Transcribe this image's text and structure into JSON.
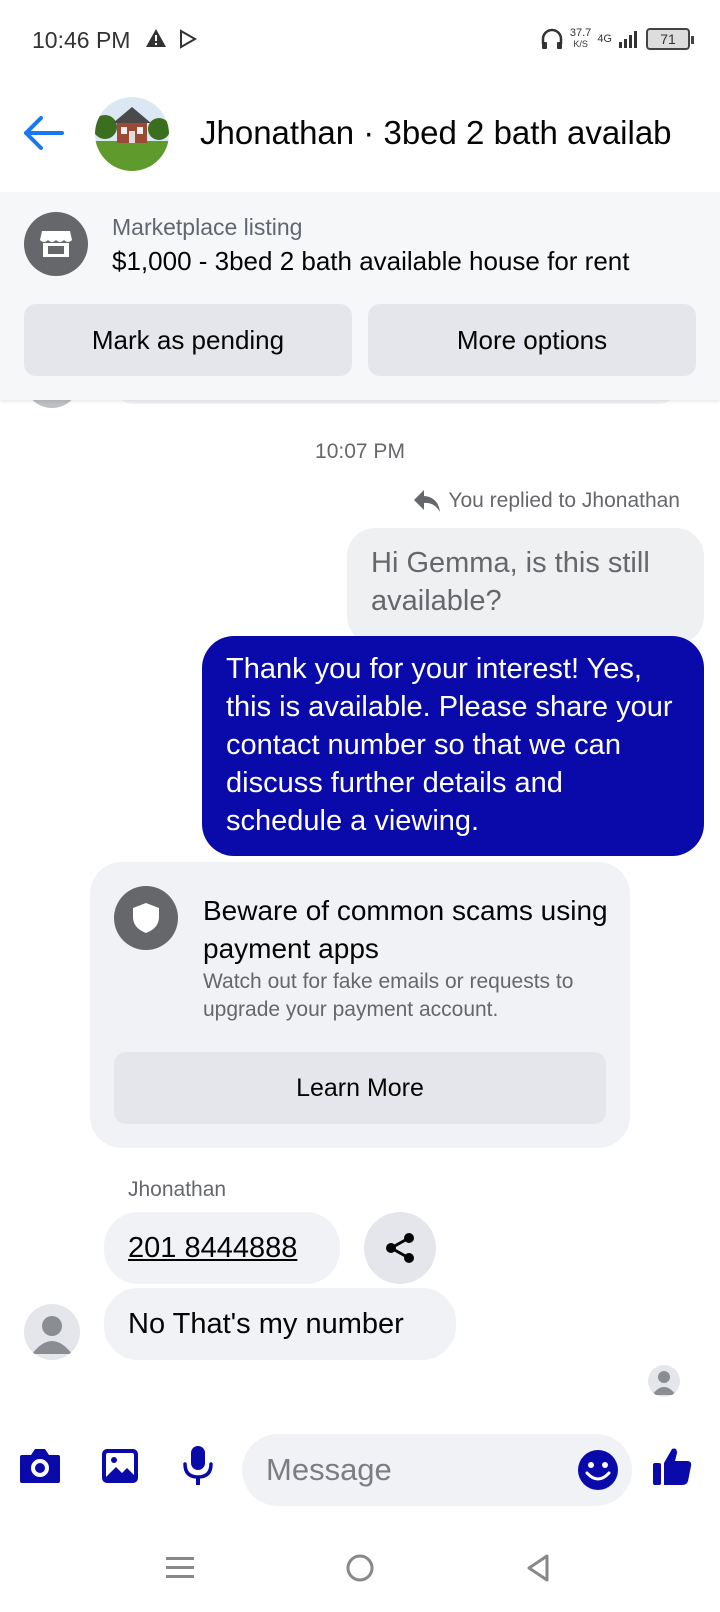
{
  "status_bar": {
    "time": "10:46 PM",
    "speed_value": "37.7",
    "speed_unit": "K/S",
    "network": "4G",
    "battery": "71"
  },
  "header": {
    "title": "Jhonathan · 3bed 2 bath availab"
  },
  "listing": {
    "label": "Marketplace listing",
    "price_title": "$1,000 - 3bed 2 bath available house for rent",
    "mark_pending": "Mark as pending",
    "more_options": "More options"
  },
  "chat": {
    "timestamp": "10:07 PM",
    "reply_note": "You replied to Jhonathan",
    "quoted_message": "Hi Gemma, is this still available?",
    "sent_message": "Thank you for your interest! Yes, this is available. Please share your contact number so that we can discuss further details and schedule a viewing.",
    "warning": {
      "title": "Beware of common scams using payment apps",
      "body": "Watch out for fake emails or requests to upgrade your payment account.",
      "button": "Learn More"
    },
    "sender_name": "Jhonathan",
    "phone_message": "201 8444888",
    "last_message": "No That's my number"
  },
  "composer": {
    "placeholder": "Message"
  },
  "colors": {
    "accent_blue": "#1877f2",
    "composer_icons": "#0a0aaa",
    "sent_bubble": "#0a0aaa"
  },
  "icons": [
    "back-arrow-icon",
    "storefront-icon",
    "shield-icon",
    "share-icon",
    "camera-icon",
    "image-icon",
    "microphone-icon",
    "emoji-icon",
    "thumbs-up-icon",
    "menu-icon",
    "home-circle-icon",
    "back-triangle-icon"
  ]
}
